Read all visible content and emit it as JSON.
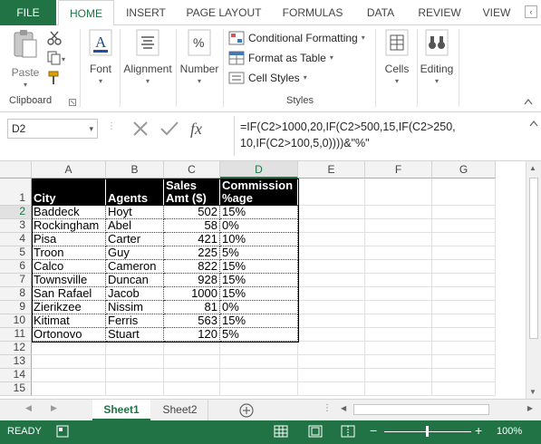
{
  "tabs": [
    "FILE",
    "HOME",
    "INSERT",
    "PAGE LAYOUT",
    "FORMULAS",
    "DATA",
    "REVIEW",
    "VIEW"
  ],
  "ribbon": {
    "clipboard": {
      "paste": "Paste",
      "label": "Clipboard"
    },
    "font": "Font",
    "alignment": "Alignment",
    "number": "Number",
    "conditional_formatting": "Conditional Formatting",
    "format_as_table": "Format as Table",
    "cell_styles": "Cell Styles",
    "styles_label": "Styles",
    "cells": "Cells",
    "editing": "Editing"
  },
  "formula_bar": {
    "name_box": "D2",
    "fx": "fx",
    "formula": "=IF(C2>1000,20,IF(C2>500,15,IF(C2>250,\n10,IF(C2>100,5,0))))&\"%\""
  },
  "columns": [
    "A",
    "B",
    "C",
    "D",
    "E",
    "F",
    "G"
  ],
  "rows": [
    "1",
    "2",
    "3",
    "4",
    "5",
    "6",
    "7",
    "8",
    "9",
    "10",
    "11",
    "12",
    "13",
    "14",
    "15"
  ],
  "table": {
    "headers": [
      "City",
      "Agents",
      "Sales Amt ($)",
      "Commission %age"
    ],
    "rows": [
      [
        "Baddeck",
        "Hoyt",
        "502",
        "15%"
      ],
      [
        "Rockingham",
        "Abel",
        "58",
        "0%"
      ],
      [
        "Pisa",
        "Carter",
        "421",
        "10%"
      ],
      [
        "Troon",
        "Guy",
        "225",
        "5%"
      ],
      [
        "Calco",
        "Cameron",
        "822",
        "15%"
      ],
      [
        "Townsville",
        "Duncan",
        "928",
        "15%"
      ],
      [
        "San Rafael",
        "Jacob",
        "1000",
        "15%"
      ],
      [
        "Zierikzee",
        "Nissim",
        "81",
        "0%"
      ],
      [
        "Kitimat",
        "Ferris",
        "563",
        "15%"
      ],
      [
        "Ortonovo",
        "Stuart",
        "120",
        "5%"
      ]
    ]
  },
  "sheets": [
    "Sheet1",
    "Sheet2"
  ],
  "status": {
    "ready": "READY",
    "zoom": "100%"
  },
  "colors": {
    "accent": "#217346",
    "header_bg": "#000000"
  }
}
